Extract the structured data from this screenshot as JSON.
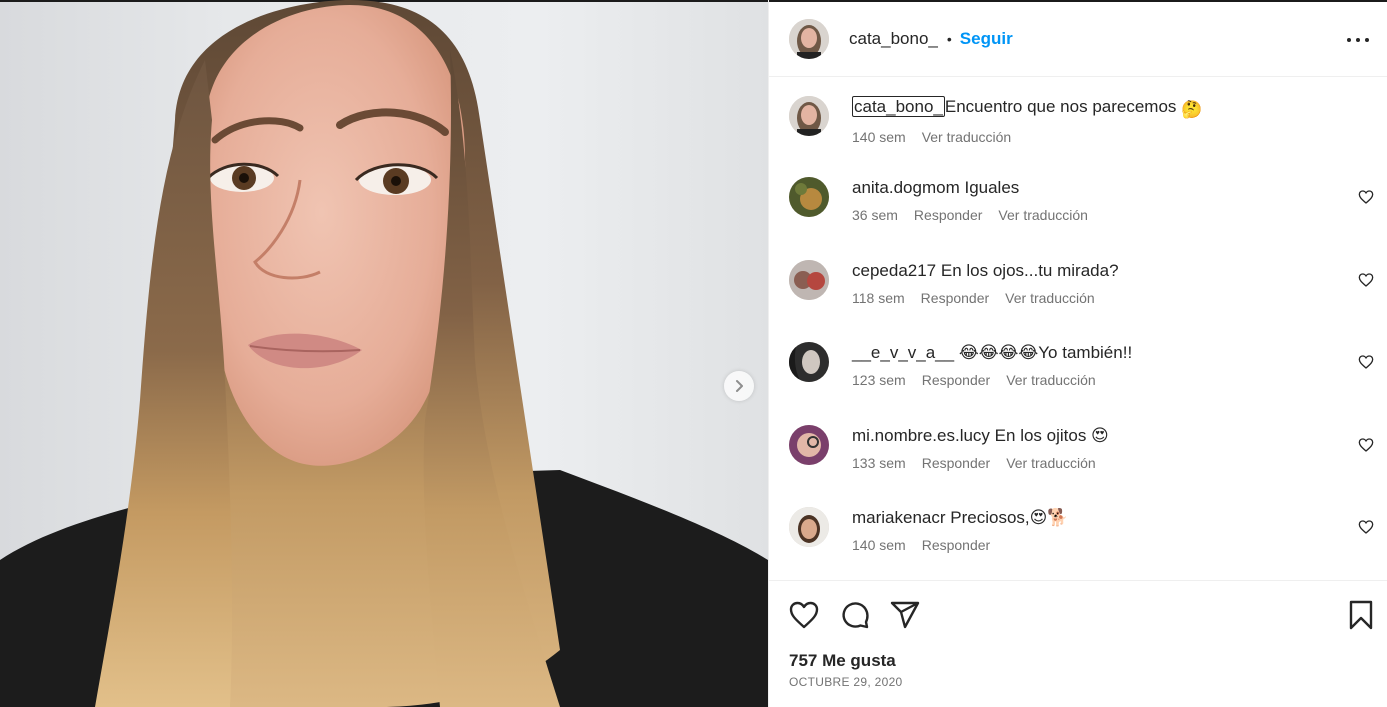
{
  "header": {
    "username": "cata_bono_",
    "separator": "•",
    "follow_label": "Seguir",
    "more_icon": "more-horizontal-icon"
  },
  "caption": {
    "username": "cata_bono_",
    "text": "Encuentro que nos parecemos",
    "emoji": "🤔",
    "age": "140 sem",
    "translate": "Ver traducción"
  },
  "comments": [
    {
      "username": "anita.dogmom",
      "text": "Iguales",
      "age": "36 sem",
      "reply": "Responder",
      "translate": "Ver traducción"
    },
    {
      "username": "cepeda217",
      "text": "En los ojos...tu mirada?",
      "age": "118 sem",
      "reply": "Responder",
      "translate": "Ver traducción"
    },
    {
      "username": "__e_v_v_a__",
      "text": "😂😂😂😂Yo también!!",
      "age": "123 sem",
      "reply": "Responder",
      "translate": "Ver traducción"
    },
    {
      "username": "mi.nombre.es.lucy",
      "text": "En los ojitos 😍",
      "age": "133 sem",
      "reply": "Responder",
      "translate": "Ver traducción"
    },
    {
      "username": "mariakenacr",
      "text": "Preciosos,😍🐕",
      "age": "140 sem",
      "reply": "Responder"
    }
  ],
  "footer": {
    "likes": "757 Me gusta",
    "date": "OCTUBRE 29, 2020"
  },
  "icons": {
    "like": "heart-icon",
    "comment": "comment-icon",
    "share": "send-icon",
    "save": "bookmark-icon",
    "next": "chevron-right-icon"
  },
  "colors": {
    "accent": "#0095f6",
    "text": "#262626",
    "secondary": "#737373",
    "divider": "#efefef"
  }
}
